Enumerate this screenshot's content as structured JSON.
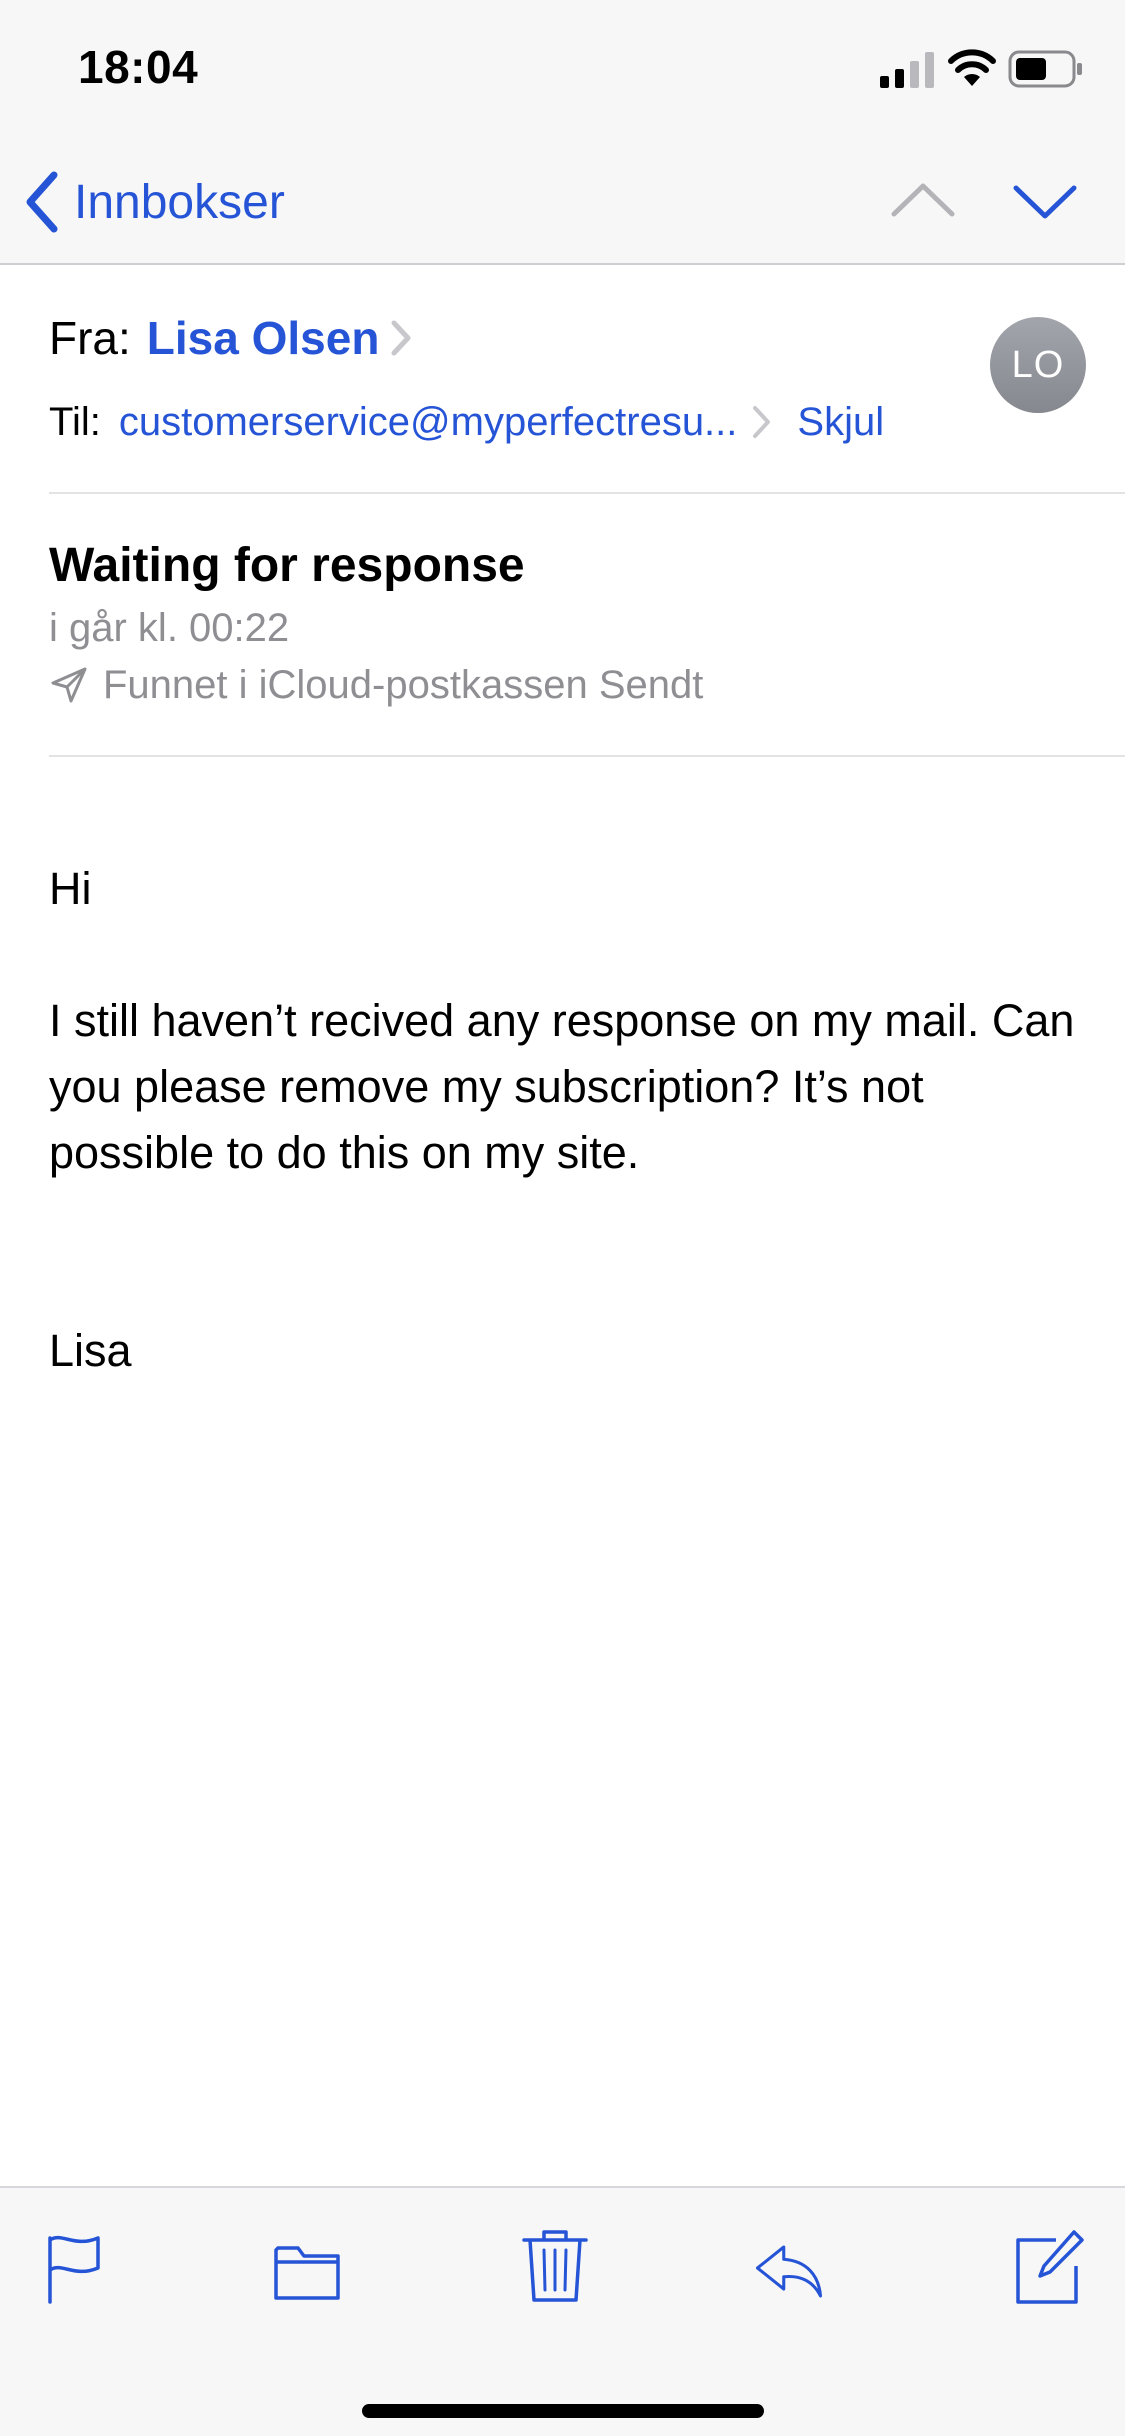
{
  "status_bar": {
    "time": "18:04"
  },
  "nav": {
    "back_label": "Innbokser"
  },
  "header": {
    "from_label": "Fra:",
    "sender_name": "Lisa Olsen",
    "to_label": "Til:",
    "recipient": "customerservice@myperfectresu...",
    "hide_label": "Skjul",
    "avatar_initials": "LO"
  },
  "message": {
    "subject": "Waiting for response",
    "date": "i går kl. 00:22",
    "location": "Funnet i iCloud-postkassen Sendt"
  },
  "body": {
    "greeting": "Hi",
    "paragraph": "I still haven’t recived any response on my mail. Can you please remove my subscription? It’s not possible to do this on my site.",
    "signature": "Lisa"
  },
  "toolbar": {
    "icons": [
      "flag-icon",
      "folder-icon",
      "trash-icon",
      "reply-icon",
      "compose-icon"
    ]
  },
  "colors": {
    "accent": "#2554d6",
    "secondary_text": "#8e8e93",
    "avatar_bg": "#8e9196"
  }
}
